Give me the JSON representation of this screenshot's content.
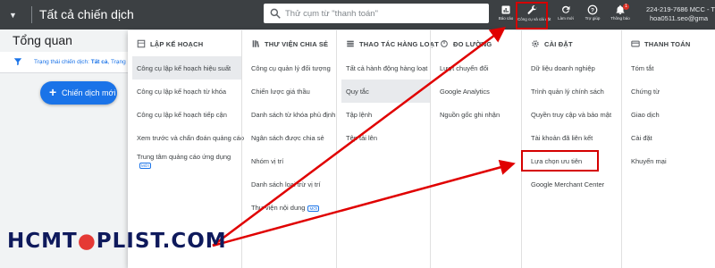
{
  "topbar": {
    "title": "Tất cả chiến dịch",
    "search_placeholder": "Thử cụm từ \"thanh toán\"",
    "tools": [
      {
        "icon": "reports-icon",
        "label": "Báo cáo"
      },
      {
        "icon": "wrench-icon",
        "label": "Công cụ và cài đặt"
      },
      {
        "icon": "refresh-icon",
        "label": "Làm mới"
      },
      {
        "icon": "help-icon",
        "label": "Trợ giúp"
      },
      {
        "icon": "bell-icon",
        "label": "Thông báo",
        "badge": "1"
      }
    ],
    "account_line1": "224-219-7686 MCC - Tài khoả",
    "account_line2": "hoa0511.seo@gma"
  },
  "left": {
    "overview_title": "Tổng quan",
    "filter_label": "Trạng thái chiến dịch: ",
    "filter_value": "Tất cả",
    "filter_tail": ", Trạng",
    "new_campaign_label": "Chiến dịch mới"
  },
  "menu": {
    "columns": [
      {
        "title": "LẬP KẾ HOẠCH",
        "items": [
          {
            "label": "Công cụ lập kế hoạch hiệu suất",
            "active": true
          },
          {
            "label": "Công cụ lập kế hoạch từ khóa"
          },
          {
            "label": "Công cụ lập kế hoạch tiếp cận"
          },
          {
            "label": "Xem trước và chẩn đoán quảng cáo"
          },
          {
            "label": "Trung tâm quảng cáo ứng dụng",
            "badge": "MỚI"
          }
        ]
      },
      {
        "title": "THƯ VIỆN CHIA SẺ",
        "items": [
          {
            "label": "Công cụ quản lý đối tượng"
          },
          {
            "label": "Chiến lược giá thầu"
          },
          {
            "label": "Danh sách từ khóa phủ định"
          },
          {
            "label": "Ngân sách được chia sẻ"
          },
          {
            "label": "Nhóm vị trí"
          },
          {
            "label": "Danh sách loại trừ vị trí"
          },
          {
            "label": "Thư viện nội dung",
            "badge": "MỚI"
          }
        ]
      },
      {
        "title": "THAO TÁC HÀNG LOẠT",
        "items": [
          {
            "label": "Tất cả hành động hàng loạt"
          },
          {
            "label": "Quy tắc",
            "active": true
          },
          {
            "label": "Tập lệnh"
          },
          {
            "label": "Tệp tải lên"
          }
        ]
      },
      {
        "title": "ĐO LƯỜNG",
        "items": [
          {
            "label": "Lượt chuyển đổi"
          },
          {
            "label": "Google Analytics"
          },
          {
            "label": "Nguồn gốc ghi nhận"
          }
        ]
      },
      {
        "title": "CÀI ĐẶT",
        "items": [
          {
            "label": "Dữ liệu doanh nghiệp"
          },
          {
            "label": "Trình quản lý chính sách"
          },
          {
            "label": "Quyền truy cập và bảo mật"
          },
          {
            "label": "Tài khoản đã liên kết"
          },
          {
            "label": "Lựa chọn ưu tiên"
          },
          {
            "label": "Google Merchant Center"
          }
        ]
      },
      {
        "title": "THANH TOÁN",
        "items": [
          {
            "label": "Tóm tắt"
          },
          {
            "label": "Chứng từ"
          },
          {
            "label": "Giao dịch"
          },
          {
            "label": "Cài đặt"
          },
          {
            "label": "Khuyến mại"
          }
        ]
      }
    ]
  },
  "watermark": {
    "part1": "HCMT",
    "part2": "PLIST.COM"
  },
  "colors": {
    "topbar": "#3c4043",
    "accent": "#1a73e8",
    "annotation": "#d50000"
  }
}
